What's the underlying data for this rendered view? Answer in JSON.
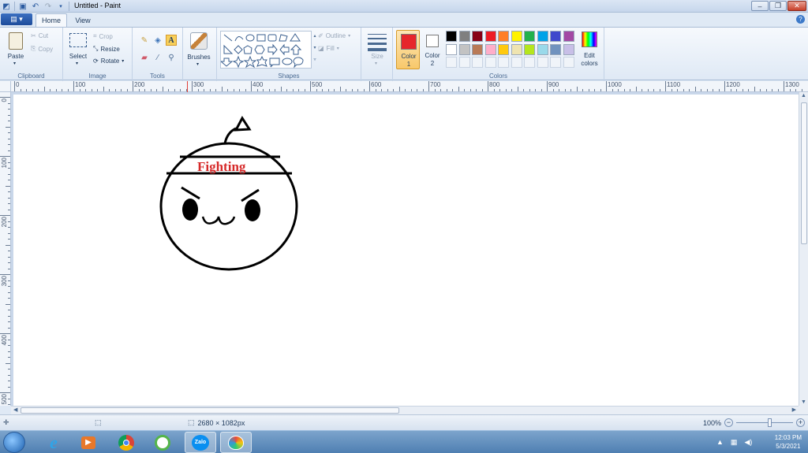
{
  "window": {
    "title": "Untitled - Paint"
  },
  "tabs": [
    {
      "label": "Home"
    },
    {
      "label": "View"
    }
  ],
  "ribbon": {
    "clipboard": {
      "paste": "Paste",
      "cut": "Cut",
      "copy": "Copy",
      "label": "Clipboard"
    },
    "image": {
      "select": "Select",
      "crop": "Crop",
      "resize": "Resize",
      "rotate": "Rotate",
      "label": "Image"
    },
    "tools": {
      "label": "Tools"
    },
    "brushes": {
      "label": "Brushes"
    },
    "shapes": {
      "outline": "Outline",
      "fill": "Fill",
      "label": "Shapes"
    },
    "size": {
      "label": "Size"
    },
    "colors": {
      "color1_label": "Color",
      "color1_num": "1",
      "color2_label": "Color",
      "color2_num": "2",
      "edit_colors_1": "Edit",
      "edit_colors_2": "colors",
      "label": "Colors",
      "color1": "#e6262b",
      "color2": "#ffffff",
      "palette_row1": [
        "#000000",
        "#7f7f7f",
        "#880015",
        "#ed1c24",
        "#ff7f27",
        "#fff200",
        "#22b14c",
        "#00a2e8",
        "#3f48cc",
        "#a349a4"
      ],
      "palette_row2": [
        "#ffffff",
        "#c3c3c3",
        "#b97a57",
        "#ffaec9",
        "#ffc90e",
        "#efe4b0",
        "#b5e61d",
        "#99d9ea",
        "#7092be",
        "#c8bfe7"
      ]
    }
  },
  "ruler": {
    "h_labels": [
      "0",
      "100",
      "200",
      "300",
      "400",
      "500",
      "600",
      "700",
      "800",
      "900",
      "1000",
      "1100",
      "1200",
      "1300"
    ],
    "v_labels": [
      "0",
      "100",
      "200",
      "300",
      "400",
      "500"
    ]
  },
  "drawing": {
    "headband_text": "Fighting",
    "headband_color": "#d62a2a"
  },
  "status": {
    "canvas_size": "2680 × 1082px",
    "zoom": "100%"
  },
  "taskbar": {
    "apps": [
      "internet-explorer",
      "media-player",
      "chrome",
      "app-icon",
      "zalo",
      "paint"
    ],
    "zalo_label": "Zalo",
    "time": "12:03 PM",
    "date": "5/3/2021"
  }
}
